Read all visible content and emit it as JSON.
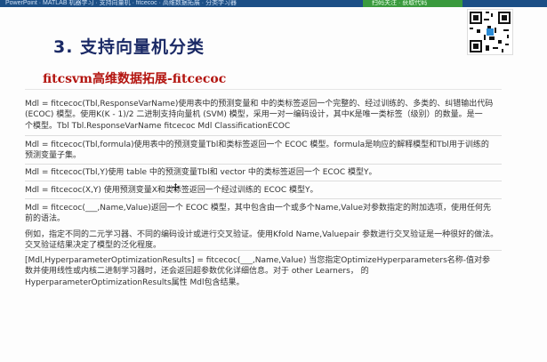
{
  "top_bar": {
    "text": "PowerPoint · MATLAB 机器学习 · 支持向量机 · fitcecoc · 高维数据拓展 · 分类学习器",
    "green_text": "扫码关注 · 获取代码"
  },
  "slide": {
    "title": "3. 支持向量机分类",
    "subtitle": "fitcsvm高维数据拓展-fitcecoc"
  },
  "qr_icon": "qr-code",
  "blocks": [
    {
      "lines": [
        "Mdl = fitcecoc(Tbl,ResponseVarName)使用表中的预测变量和 中的类标签返回一个完整的、经过训练的、多类的、纠错输出代码",
        "(ECOC) 模型。使用K(K - 1)/2 二进制支持向量机 (SVM) 模型，采用一对一编码设计，其中K是唯一类标签（级别）的数量。是一",
        "个模型。Tbl Tbl.ResponseVarName fitcecoc Mdl ClassificationECOC"
      ]
    },
    {
      "lines": [
        "Mdl = fitcecoc(Tbl,formula)使用表中的预测变量Tbl和类标签返回一个 ECOC 模型。formula是响应的解释模型和Tbl用于训练的",
        "预测变量子集。"
      ]
    },
    {
      "lines": [
        "Mdl = fitcecoc(Tbl,Y)使用 table 中的预测变量Tbl和 vector 中的类标签返回一个 ECOC 模型Y。"
      ]
    },
    {
      "lines": [
        "Mdl = fitcecoc(X,Y) 使用预测变量X和类标签返回一个经过训练的 ECOC 模型Y。"
      ]
    },
    {
      "lines": [
        "Mdl = fitcecoc(___,Name,Value)返回一个 ECOC 模型，其中包含由一个或多个Name,Value对参数指定的附加选项，使用任何先",
        "前的语法。",
        "例如，指定不同的二元学习器、不同的编码设计或进行交叉验证。使用Kfold Name,Valuepair 参数进行交叉验证是一种很好的做法。",
        "交叉验证结果决定了模型的泛化程度。"
      ]
    },
    {
      "lines": [
        "[Mdl,HyperparameterOptimizationResults] = fitcecoc(___,Name,Value) 当您指定OptimizeHyperparameters名称-值对参",
        "数并使用线性或内核二进制学习器时，还会返回超参数优化详细信息。对于 other Learners， 的",
        "HyperparameterOptimizationResults属性 Mdl包含结果。"
      ]
    }
  ]
}
